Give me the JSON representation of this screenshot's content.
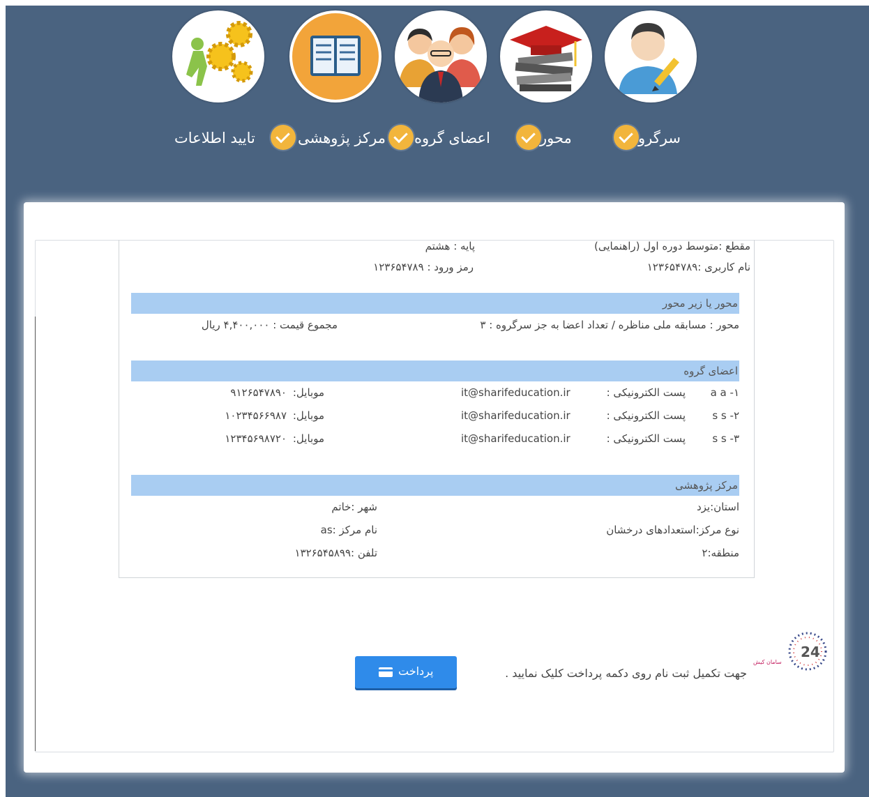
{
  "steps": [
    {
      "label": "سرگروه",
      "icon": "leader-avatar-icon"
    },
    {
      "label": "محور",
      "icon": "graduation-books-icon"
    },
    {
      "label": "اعضای گروه",
      "icon": "team-members-icon"
    },
    {
      "label": "مرکز پژوهشی",
      "icon": "research-book-icon"
    },
    {
      "label": "تایید اطلاعات",
      "icon": "gears-confirm-icon"
    }
  ],
  "leader": {
    "grade_level": "مقطع :متوسط دوره اول (راهنمایی)",
    "grade": "پایه : هشتم",
    "username": "نام کاربری :۱۲۳۶۵۴۷۸۹",
    "password": "رمز ورود : ۱۲۳۶۵۴۷۸۹"
  },
  "axis": {
    "header": "محور یا زیر محور",
    "detail": "محور : مسابقه ملی مناظره / تعداد اعضا به جز سرگروه : ۳",
    "total": "مجموع قیمت : ۴,۴۰۰,۰۰۰ ریال"
  },
  "members": {
    "header": "اعضای گروه",
    "email_label": "پست الکترونیکی :",
    "mobile_label": "موبایل:",
    "rows": [
      {
        "name": "۱- a a",
        "email": "it@sharifeducation.ir",
        "mobile": "۹۱۲۶۵۴۷۸۹۰"
      },
      {
        "name": "۲- s s",
        "email": "it@sharifeducation.ir",
        "mobile": "۱۰۲۳۴۵۶۶۹۸۷"
      },
      {
        "name": "۳- s s",
        "email": "it@sharifeducation.ir",
        "mobile": "۱۲۳۴۵۶۹۸۷۲۰"
      }
    ]
  },
  "center": {
    "header": "مرکز پژوهشی",
    "province": "استان:یزد",
    "city": "شهر :خاتم",
    "type": "نوع مرکز:استعدادهای درخشان",
    "name": "نام مرکز :as",
    "region": "منطقه:۲",
    "phone": "تلفن :۱۳۲۶۵۴۵۸۹۹"
  },
  "payment": {
    "instruction": "جهت تکمیل ثبت نام روی دکمه پرداخت کلیک نمایید .",
    "button_label": "پرداخت",
    "logo_text": "سامان کیش",
    "logo_number": "24"
  },
  "colors": {
    "background": "#4a6380",
    "check": "#f2b53c",
    "section_header": "#a9cdf2",
    "button": "#2f8bea"
  }
}
